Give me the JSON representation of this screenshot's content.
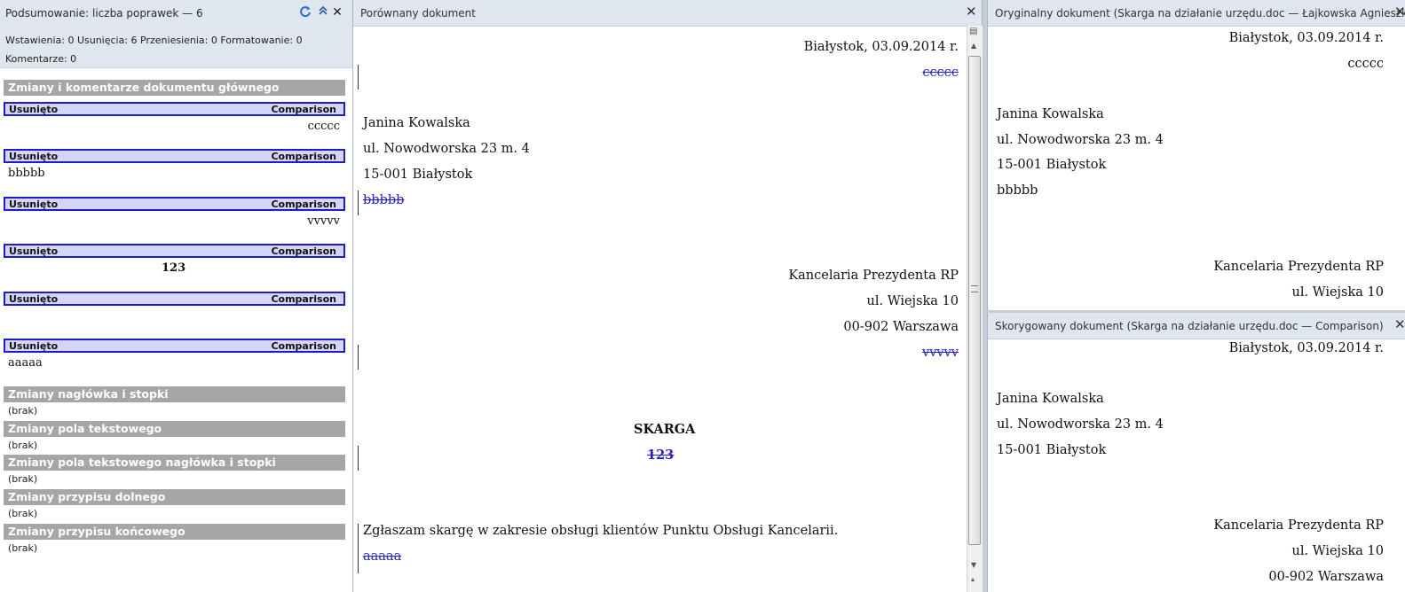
{
  "summary": {
    "title": "Podsumowanie: liczba poprawek — 6",
    "stats_line1": "Wstawienia: 0  Usunięcia: 6  Przeniesienia: 0  Formatowanie: 0",
    "stats_line2": "Komentarze: 0",
    "main_section": "Zmiany i komentarze dokumentu głównego",
    "revisions": [
      {
        "type": "Usunięto",
        "author": "Comparison",
        "text": "ccccc"
      },
      {
        "type": "Usunięto",
        "author": "Comparison",
        "text": "bbbbb"
      },
      {
        "type": "Usunięto",
        "author": "Comparison",
        "text": "vvvvv"
      },
      {
        "type": "Usunięto",
        "author": "Comparison",
        "text": "123"
      },
      {
        "type": "Usunięto",
        "author": "Comparison",
        "text": ""
      },
      {
        "type": "Usunięto",
        "author": "Comparison",
        "text": "aaaaa"
      }
    ],
    "other_sections": [
      {
        "title": "Zmiany nagłówka i stopki",
        "value": "(brak)"
      },
      {
        "title": "Zmiany pola tekstowego",
        "value": "(brak)"
      },
      {
        "title": "Zmiany pola tekstowego nagłówka i stopki",
        "value": "(brak)"
      },
      {
        "title": "Zmiany przypisu dolnego",
        "value": "(brak)"
      },
      {
        "title": "Zmiany przypisu końcowego",
        "value": "(brak)"
      }
    ],
    "icons": [
      "refresh-icon",
      "collapse-icon",
      "close-icon"
    ]
  },
  "compared": {
    "title": "Porównany dokument",
    "date": "Białystok, 03.09.2014 r.",
    "del_ccccc": "ccccc",
    "name": "Janina Kowalska",
    "street": "ul. Nowodworska 23 m. 4",
    "city": "15-001 Białystok",
    "del_bbbbb": "bbbbb",
    "recipient": "Kancelaria Prezydenta RP",
    "rstreet": "ul. Wiejska 10",
    "rcity": "00-902 Warszawa",
    "del_vvvvv": "vvvvv",
    "heading": "SKARGA",
    "del_123": "123",
    "body": "Zgłaszam skargę w zakresie obsługi klientów Punktu Obsługi Kancelarii.",
    "del_aaaaa": "aaaaa",
    "deletion_color": "#2323c7"
  },
  "original": {
    "title": "Oryginalny dokument (Skarga na działanie urzędu.doc — Łajkowska Agnieszka)",
    "date": "Białystok, 03.09.2014 r.",
    "ccccc": "ccccc",
    "name": "Janina Kowalska",
    "street": "ul. Nowodworska 23 m. 4",
    "city": "15-001 Białystok",
    "bbbbb": "bbbbb",
    "recipient": "Kancelaria Prezydenta RP",
    "rstreet": "ul. Wiejska 10"
  },
  "revised": {
    "title": "Skorygowany dokument (Skarga na działanie urzędu.doc — Comparison)",
    "date": "Białystok, 03.09.2014 r.",
    "name": "Janina Kowalska",
    "street": "ul. Nowodworska 23 m. 4",
    "city": "15-001 Białystok",
    "recipient": "Kancelaria Prezydenta RP",
    "rstreet": "ul. Wiejska 10",
    "rcity": "00-902 Warszawa"
  }
}
